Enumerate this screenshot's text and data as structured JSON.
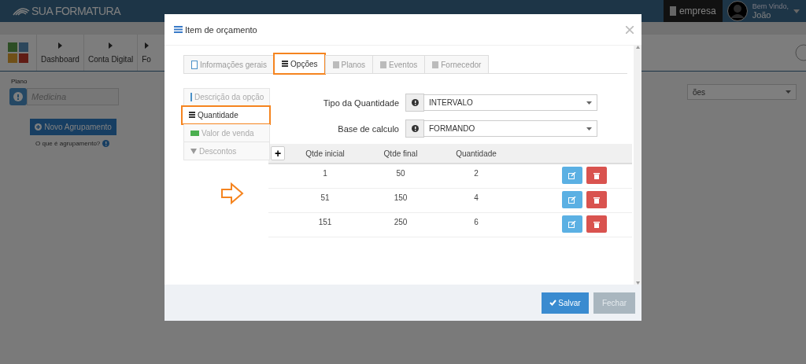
{
  "topbar": {
    "logo": "SUA FORMATURA",
    "company": "empresa",
    "welcome": "Bem Vindo,",
    "user": "João"
  },
  "nav": [
    {
      "label": "Dashboard"
    },
    {
      "label": "Conta Digital"
    },
    {
      "label": "Fo"
    }
  ],
  "page": {
    "plano_label": "Plano",
    "plano_value": "Medicina",
    "new_button": "Novo Agrupamento",
    "help_link": "O que é agrupamento?",
    "select_value": "ões"
  },
  "modal": {
    "title": "Item de orçamento",
    "tabs": [
      {
        "label": "Informações gerais",
        "selected": false
      },
      {
        "label": "Opções",
        "selected": true
      },
      {
        "label": "Planos",
        "selected": false
      },
      {
        "label": "Eventos",
        "selected": false
      },
      {
        "label": "Fornecedor",
        "selected": false
      }
    ],
    "subnav": [
      {
        "label": "Descrição da opção",
        "selected": false
      },
      {
        "label": "Quantidade",
        "selected": true
      },
      {
        "label": "Valor de venda",
        "selected": false
      },
      {
        "label": "Descontos",
        "selected": false
      }
    ],
    "fields": [
      {
        "label": "Tipo da Quantidade",
        "value": "INTERVALO"
      },
      {
        "label": "Base de calculo",
        "value": "FORMANDO"
      }
    ],
    "table": {
      "add": "+",
      "columns": [
        "Qtde inicial",
        "Qtde final",
        "Quantidade"
      ],
      "rows": [
        [
          "1",
          "50",
          "2"
        ],
        [
          "51",
          "150",
          "4"
        ],
        [
          "151",
          "250",
          "6"
        ]
      ]
    },
    "buttons": {
      "save": "Salvar",
      "close": "Fechar"
    }
  }
}
